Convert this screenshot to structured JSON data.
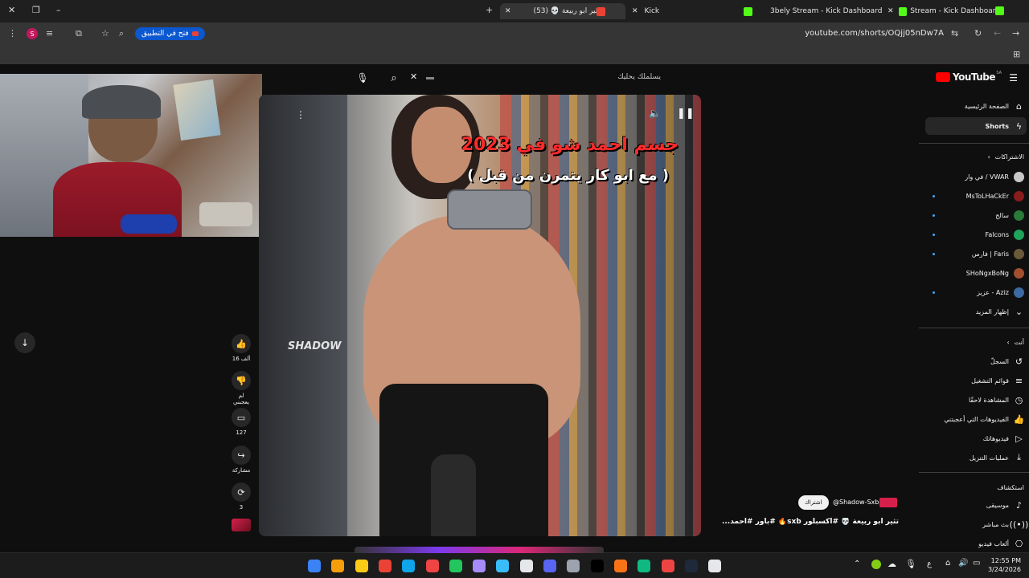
{
  "browser": {
    "tabs": [
      {
        "label": "ثاثير ابو ربيعة 💀 (53)",
        "active": true
      },
      {
        "label": "Kick",
        "active": false
      },
      {
        "label": "3bely Stream - Kick Dashboard",
        "active": false
      },
      {
        "label": "Stream - Kick Dashboard",
        "active": false
      }
    ],
    "open_in_app_label": "فتح في التطبيق",
    "url": "youtube.com/shorts/OQjj05nDw7A",
    "profile_initial": "S"
  },
  "youtube": {
    "logo_text": "YouTube",
    "logo_region": "SA",
    "search_placeholder": "يسلملك يحليك",
    "nav": [
      {
        "label": "الصفحة الرئيسية",
        "icon": "home-icon"
      },
      {
        "label": "Shorts",
        "icon": "shorts-icon",
        "active": true
      }
    ],
    "subscriptions_header": "الاشتراكات",
    "subscriptions": [
      {
        "label": "في وار / VWAR",
        "avatar": "#c8c8c8",
        "dot": false
      },
      {
        "label": "MsToLHaCkEr",
        "avatar": "#8a1c1c",
        "dot": true
      },
      {
        "label": "سالح",
        "avatar": "#2a7a3a",
        "dot": true
      },
      {
        "label": "Falcons",
        "avatar": "#1fa35a",
        "dot": true
      },
      {
        "label": "فارس | Faris",
        "avatar": "#6b5a3a",
        "dot": true
      },
      {
        "label": "SHoNgxBoNg",
        "avatar": "#a05030",
        "dot": false
      },
      {
        "label": "عزيز - Aziz",
        "avatar": "#3a6aa0",
        "dot": true
      }
    ],
    "show_more": "إظهار المزيد",
    "you_header": "أنت",
    "you_items": [
      {
        "label": "السجلّ",
        "icon": "history-icon"
      },
      {
        "label": "قوائم التشغيل",
        "icon": "playlist-icon"
      },
      {
        "label": "المشاهدة لاحقًا",
        "icon": "watch-later-icon"
      },
      {
        "label": "الفيديوهات التي أعجبتني",
        "icon": "thumbs-up-icon"
      },
      {
        "label": "فيديوهاتك",
        "icon": "your-videos-icon"
      },
      {
        "label": "عمليات التنزيل",
        "icon": "download-icon"
      }
    ],
    "explore_header": "استكشاف",
    "explore_items": [
      {
        "label": "موسيقى",
        "icon": "music-icon"
      },
      {
        "label": "بث مباشر",
        "icon": "live-icon"
      },
      {
        "label": "ألعاب فيديو",
        "icon": "gaming-icon"
      }
    ]
  },
  "short": {
    "overlay_title": "جسم احمد شو في 2023",
    "overlay_subtitle": "( مع ابو كار يتمرن من قبل )",
    "watermark": "SHADOW",
    "channel": "@Shadow-Sxb",
    "subscribe_label": "اشتراك",
    "caption": "تثير ابو ربيعة 💀 #اكسبلور sxb🔥 #باور #احمد...",
    "likes": "16 ألف",
    "dislike_label": "لم يعجبني",
    "comments": "127",
    "share_label": "مشاركة",
    "remix_count": "3"
  },
  "taskbar": {
    "time": "12:55 PM",
    "date": "3/24/2026",
    "lang": "ع",
    "app_colors": [
      "#3b82f6",
      "#f59e0b",
      "#facc15",
      "#ea4335",
      "#0ea5e9",
      "#ef4444",
      "#22c55e",
      "#a78bfa",
      "#38bdf8",
      "#e5e7eb",
      "#5865f2",
      "#9ca3af",
      "#000000",
      "#f97316",
      "#10b981",
      "#ef4444",
      "#1e293b",
      "#e5e7eb"
    ]
  }
}
